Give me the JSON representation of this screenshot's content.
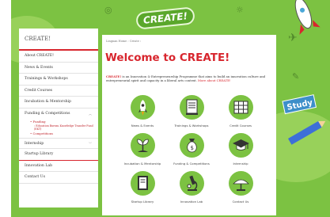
{
  "banner": "CREATE!",
  "sidebar": {
    "title": "CREATE!",
    "items": [
      {
        "label": "About CREATE!"
      },
      {
        "label": "News & Events"
      },
      {
        "label": "Trainings & Workshops"
      },
      {
        "label": "Credit Courses"
      },
      {
        "label": "Incubation & Mentorship"
      },
      {
        "label": "Funding & Competitions"
      }
    ],
    "funding_sub": [
      "Funding",
      "Education Bureau Knowledge Transfer Fund (EKT)",
      "Competitions"
    ],
    "more_items": [
      {
        "label": "Internship"
      },
      {
        "label": "Startup Library"
      },
      {
        "label": "Innovation Lab"
      },
      {
        "label": "Contact Us"
      }
    ]
  },
  "breadcrumb": "Lingnan Home  ›  Create  ›",
  "page_title": "Welcome to CREATE!",
  "intro": {
    "brand": "CREATE!",
    "text": " is an Innovation & Entrepreneurship Programme that aims to build an innovation culture and entrepreneurial spirit and capacity in a liberal arts context. ",
    "link": "More about CREATE!"
  },
  "tiles": [
    {
      "label": "News & Events",
      "icon": "rocket-icon"
    },
    {
      "label": "Trainings & Workshops",
      "icon": "document-icon"
    },
    {
      "label": "Credit Courses",
      "icon": "books-icon"
    },
    {
      "label": "Incubation & Mentorship",
      "icon": "plant-icon"
    },
    {
      "label": "Funding & Competitions",
      "icon": "money-bag-icon"
    },
    {
      "label": "Internship",
      "icon": "graduation-cap-icon"
    },
    {
      "label": "Startup Library",
      "icon": "book-icon"
    },
    {
      "label": "Innovation Lab",
      "icon": "microscope-icon"
    },
    {
      "label": "Contact Us",
      "icon": "satellite-dish-icon"
    }
  ],
  "deco": {
    "study": "Study"
  },
  "colors": {
    "accent": "#d8262e",
    "green": "#7cc242"
  }
}
